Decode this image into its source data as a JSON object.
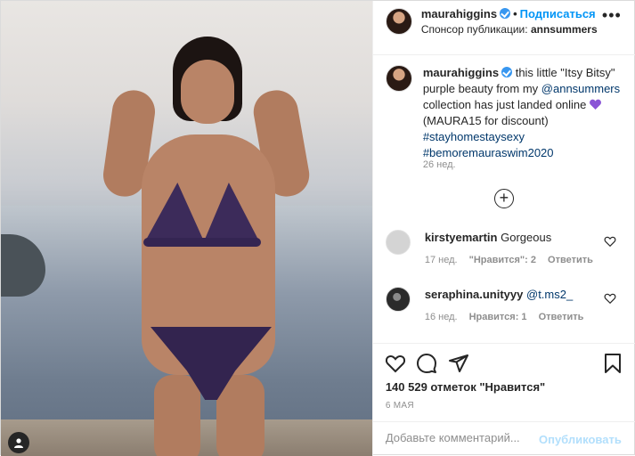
{
  "header": {
    "username": "maurahiggins",
    "follow_label": "Подписаться",
    "sponsor_prefix": "Спонсор публикации:",
    "sponsor_name": "annsummers",
    "more_label": "•••"
  },
  "caption": {
    "username": "maurahiggins",
    "text_1": "this little \"Itsy Bitsy\" purple beauty from my",
    "mention": "@annsummers",
    "text_2": "collection has just landed online",
    "text_3": "(MAURA15 for discount)",
    "hashtag_1": "#stayhomestaysexy",
    "hashtag_2": "#bemoremauraswim2020",
    "time": "26 нед."
  },
  "load_more_label": "+",
  "comments": [
    {
      "username": "kirstyemartin",
      "text": "Gorgeous",
      "time": "17 нед.",
      "likes": "\"Нравится\": 2",
      "reply": "Ответить"
    },
    {
      "username": "seraphina.unityyy",
      "mention": "@t.ms2_",
      "time": "16 нед.",
      "likes": "Нравится: 1",
      "reply": "Ответить"
    }
  ],
  "likes_text": "140 529 отметок \"Нравится\"",
  "date": "6 МАЯ",
  "add_comment": {
    "placeholder": "Добавьте комментарий...",
    "publish_label": "Опубликовать"
  },
  "colors": {
    "link": "#00376b",
    "follow": "#0095f6",
    "publish_disabled": "#b2dffc",
    "verified": "#3897f0"
  }
}
